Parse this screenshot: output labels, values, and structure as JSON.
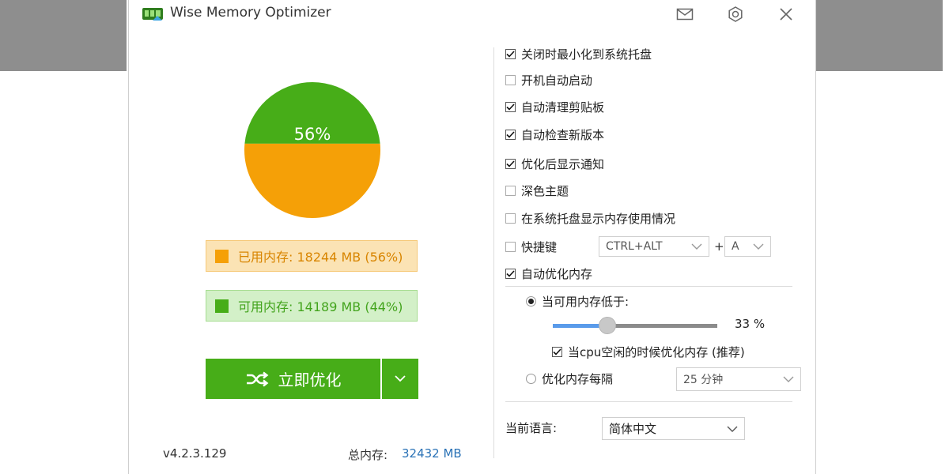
{
  "window": {
    "title": "Wise Memory Optimizer",
    "icons": {
      "logo": "memory-chip-logo",
      "mail": "mail-icon",
      "settings": "gear-icon",
      "close": "close-icon"
    }
  },
  "memory": {
    "percent_label": "56%",
    "used_fraction": 0.56,
    "used_text": "已用内存: 18244 MB (56%)",
    "available_text": "可用内存: 14189 MB (44%)",
    "used_color": "#f5a007",
    "available_color": "#47ad18"
  },
  "actions": {
    "optimize_label": "立即优化",
    "optimize_icon": "shuffle-icon",
    "dropdown_icon": "chevron-down-icon"
  },
  "footer": {
    "version": "v4.2.3.129",
    "total_label": "总内存:",
    "total_value": "32432 MB"
  },
  "settings": {
    "options": [
      {
        "label": "关闭时最小化到系统托盘",
        "checked": true
      },
      {
        "label": "开机自动启动",
        "checked": false
      },
      {
        "label": "自动清理剪贴板",
        "checked": true
      },
      {
        "label": "自动检查新版本",
        "checked": true
      },
      {
        "label": "优化后显示通知",
        "checked": true
      },
      {
        "label": "深色主题",
        "checked": false
      },
      {
        "label": "在系统托盘显示内存使用情况",
        "checked": false
      }
    ],
    "hotkey": {
      "label": "快捷键",
      "checked": false,
      "modifier": "CTRL+ALT",
      "plus": "+",
      "key": "A"
    },
    "auto_optimize": {
      "label": "自动优化内存",
      "checked": true
    },
    "threshold": {
      "label": "当可用内存低于:",
      "selected": true,
      "value_percent": 33,
      "value_text": "33 %"
    },
    "cpu_idle": {
      "label": "当cpu空闲的时候优化内存 (推荐)",
      "checked": true
    },
    "interval": {
      "label": "优化内存每隔",
      "selected": false,
      "value": "25 分钟"
    },
    "language": {
      "label": "当前语言:",
      "value": "简体中文"
    }
  }
}
